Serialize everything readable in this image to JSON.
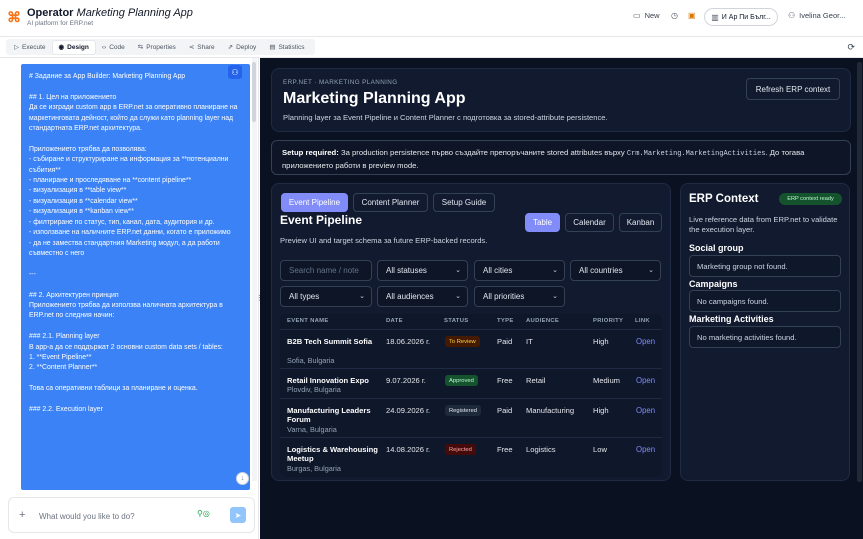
{
  "app": {
    "name": "Operator",
    "project": "Marketing Planning App",
    "subtitle": "AI platform for ERP.net"
  },
  "topbar": {
    "new_label": "New",
    "workspace": "И Ар Пи Бълг...",
    "user": "Ivelina Geor..."
  },
  "tabs": [
    {
      "label": "Execute",
      "icon": "play-icon"
    },
    {
      "label": "Design",
      "icon": "eye-icon"
    },
    {
      "label": "Code",
      "icon": "code-icon"
    },
    {
      "label": "Properties",
      "icon": "sliders-icon"
    },
    {
      "label": "Share",
      "icon": "share-icon"
    },
    {
      "label": "Deploy",
      "icon": "rocket-icon"
    },
    {
      "label": "Statistics",
      "icon": "chart-icon"
    }
  ],
  "chat": {
    "message": "# Задание за App Builder: Marketing Planning App\n\n## 1. Цел на приложението\nДа се изгради custom app в ERP.net за оперативно планиране на маркетинговата дейност, който да служи като planning layer над стандартната ERP.net архитектура.\n\nПриложението трябва да позволява:\n- събиране и структуриране на информация за **потенциални събития**\n- планиране и проследяване на **content pipeline**\n- визуализация в **table view**\n- визуализация в **calendar view**\n- визуализация в **kanban view**\n- филтриране по статус, тип, канал, дата, аудитория и др.\n- използване на наличните ERP.net данни, когато е приложимо\n- да не замества стандартния Marketing модул, а да работи съвместно с него\n\n---\n\n## 2. Архитектурен принцип\nПриложението трябва да използва наличната архитектура в ERP.net по следния начин:\n\n### 2.1. Planning layer\nВ app-а да се поддържат 2 основни custom data sets / tables:\n1. **Event Pipeline**\n2. **Content Planner**\n\nТова са оперативни таблици за планиране и оценка.\n\n### 2.2. Execution layer",
    "placeholder": "What would you like to do?"
  },
  "preview": {
    "breadcrumb": "ERP.NET · MARKETING PLANNING",
    "title": "Marketing Planning App",
    "description": "Planning layer за Event Pipeline и Content Planner с подготовка за stored-attribute persistence.",
    "refresh_label": "Refresh ERP context",
    "notice_bold": "Setup required:",
    "notice_text": " За production persistence първо създайте препоръчаните stored attributes върху ",
    "notice_code": "Crm.Marketing.MarketingActivities",
    "notice_tail": ". До тогава приложението работи в preview mode.",
    "sections": [
      "Event Pipeline",
      "Content Planner",
      "Setup Guide"
    ],
    "heading": "Event Pipeline",
    "subheading": "Preview UI and target schema за future ERP-backed records.",
    "views": [
      "Table",
      "Calendar",
      "Kanban"
    ],
    "search_placeholder": "Search name / note",
    "filters": [
      "All statuses",
      "All cities",
      "All countries",
      "All types",
      "All audiences",
      "All priorities"
    ],
    "columns": [
      "EVENT NAME",
      "DATE",
      "STATUS",
      "TYPE",
      "AUDIENCE",
      "PRIORITY",
      "LINK"
    ],
    "rows": [
      {
        "name": "B2B Tech Summit Sofia",
        "location": "Sofia, Bulgaria",
        "date": "18.06.2026 г.",
        "status": "To Review",
        "type": "Paid",
        "audience": "IT",
        "priority": "High",
        "link": "Open"
      },
      {
        "name": "Retail Innovation Expo",
        "location": "Plovdiv, Bulgaria",
        "date": "9.07.2026 г.",
        "status": "Approved",
        "type": "Free",
        "audience": "Retail",
        "priority": "Medium",
        "link": "Open"
      },
      {
        "name": "Manufacturing Leaders Forum",
        "location": "Varna, Bulgaria",
        "date": "24.09.2026 г.",
        "status": "Registered",
        "type": "Paid",
        "audience": "Manufacturing",
        "priority": "High",
        "link": "Open"
      },
      {
        "name": "Logistics & Warehousing Meetup",
        "location": "Burgas, Bulgaria",
        "date": "14.08.2026 г.",
        "status": "Rejected",
        "type": "Free",
        "audience": "Logistics",
        "priority": "Low",
        "link": "Open"
      }
    ],
    "erp": {
      "title": "ERP Context",
      "badge": "ERP context ready",
      "description": "Live reference data from ERP.net to validate the execution layer.",
      "groups": [
        {
          "heading": "Social group",
          "value": "Marketing group not found."
        },
        {
          "heading": "Campaigns",
          "value": "No campaigns found."
        },
        {
          "heading": "Marketing Activities",
          "value": "No marketing activities found."
        }
      ]
    }
  },
  "colors": {
    "accent": "#818cf8",
    "chat_bubble": "#3b82f6",
    "preview_bg": "#0a1222"
  }
}
